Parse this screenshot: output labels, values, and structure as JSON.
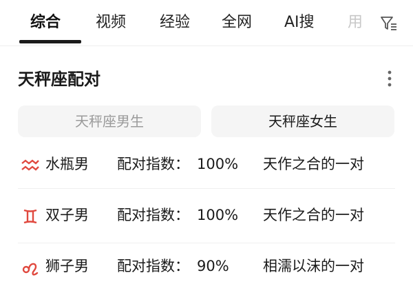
{
  "tabs": [
    {
      "label": "综合",
      "active": true
    },
    {
      "label": "视频",
      "active": false
    },
    {
      "label": "经验",
      "active": false
    },
    {
      "label": "全网",
      "active": false
    },
    {
      "label": "AI搜",
      "active": false
    },
    {
      "label": "用",
      "active": false
    }
  ],
  "icons": {
    "filter": "filter-icon",
    "more": "more-vertical-icon"
  },
  "section": {
    "title": "天秤座配对"
  },
  "segments": {
    "left": "天秤座男生",
    "right": "天秤座女生"
  },
  "rows": [
    {
      "sign_icon": "aquarius-icon",
      "name": "水瓶男",
      "index_label": "配对指数：",
      "index_value": "100%",
      "description": "天作之合的一对"
    },
    {
      "sign_icon": "gemini-icon",
      "name": "双子男",
      "index_label": "配对指数：",
      "index_value": "100%",
      "description": "天作之合的一对"
    },
    {
      "sign_icon": "leo-icon",
      "name": "狮子男",
      "index_label": "配对指数：",
      "index_value": "90%",
      "description": "相濡以沫的一对"
    }
  ],
  "colors": {
    "accent_red": "#e0483e",
    "active_tab_underline": "#1a1a1a",
    "segment_bg": "#f5f5f5"
  }
}
